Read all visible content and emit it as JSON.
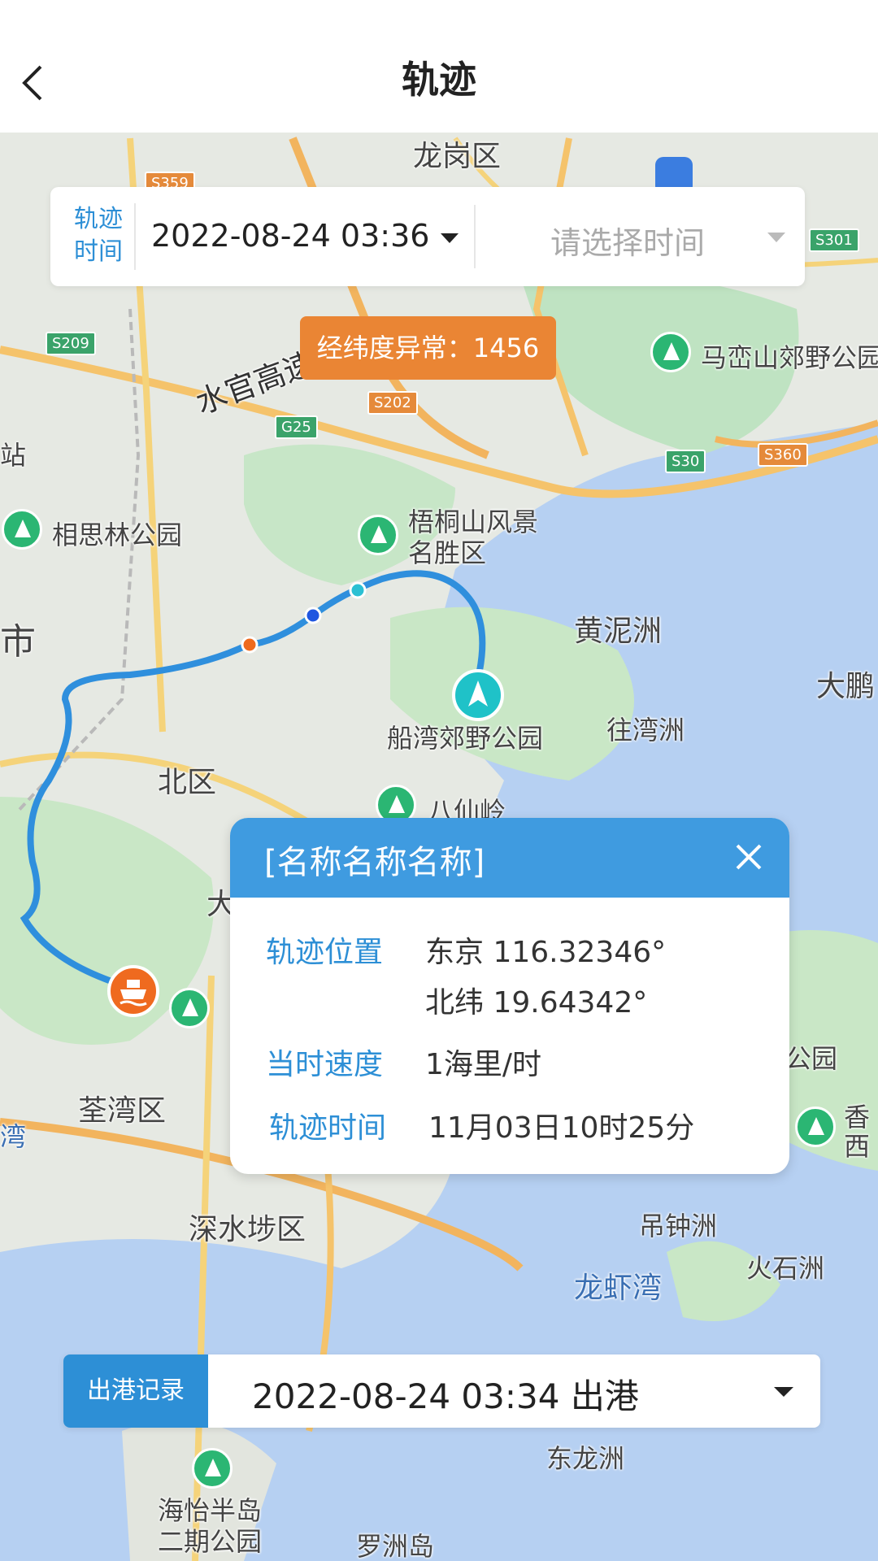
{
  "header": {
    "title": "轨迹"
  },
  "time_filter": {
    "label": "轨迹\n时间",
    "start_value": "2022-08-24 03:36",
    "end_placeholder": "请选择时间"
  },
  "warning_badge": {
    "text": "经纬度异常：1456"
  },
  "map_labels": {
    "longgang": "龙岗区",
    "shuiguan": "水官高速",
    "maluanshan": "马峦山郊野公园",
    "xiangsilin": "相思林公园",
    "wutongshan": "梧桐山风景\n名胜区",
    "huangnizhou": "黄泥洲",
    "dapeng": "大鹏",
    "shi": "市",
    "zhan": "站",
    "chuanwan": "船湾郊野公园",
    "wangwanzhou": "往湾洲",
    "beiqu": "北区",
    "baxianling": "八仙岭",
    "dabuqu": "大埔区",
    "quanwan": "荃湾区",
    "wan": "湾",
    "shenshuibu": "深水埗区",
    "diaozhongzhou": "吊钟洲",
    "huoshizhou": "火石洲",
    "longxiawan": "龙虾湾",
    "xiang": "香",
    "xi": "西",
    "gongyuan": "公园",
    "donglongzhou": "东龙洲",
    "haiyi": "海怡半岛\n二期公园",
    "luozhoudao": "罗洲岛"
  },
  "road_shields": [
    "S359",
    "S209",
    "S202",
    "G25",
    "S30",
    "S360",
    "S301"
  ],
  "popup": {
    "title": "[名称名称名称]",
    "position_label": "轨迹位置",
    "longitude": "东京 116.32346°",
    "latitude": "北纬 19.64342°",
    "speed_label": "当时速度",
    "speed_value": "1海里/时",
    "time_label": "轨迹时间",
    "time_value": "11月03日10时25分"
  },
  "port_record": {
    "label": "出港记录",
    "value": "2022-08-24 03:34 出港"
  },
  "colors": {
    "accent": "#2d8fd6",
    "warning": "#ea8534",
    "track": "#2f8fdd",
    "popup_header": "#3f9be0"
  }
}
